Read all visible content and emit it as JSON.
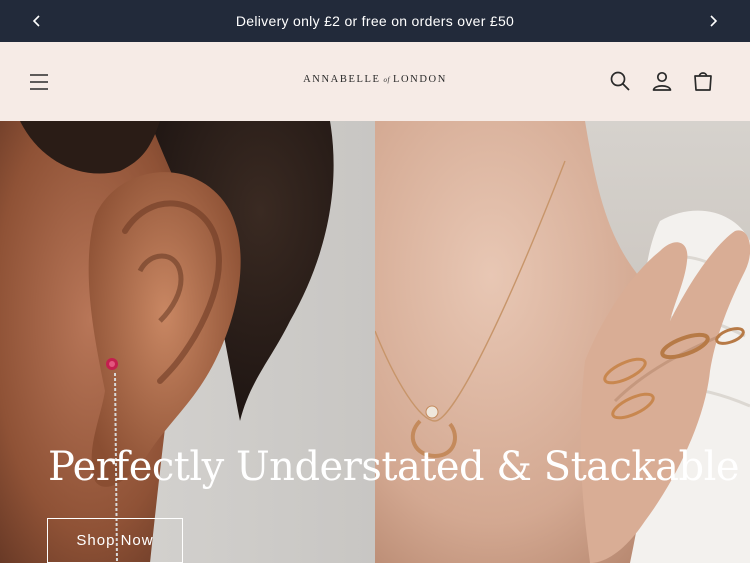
{
  "announcement": {
    "text": "Delivery only £2 or free on orders over £50",
    "prev_icon": "chevron-left-icon",
    "next_icon": "chevron-right-icon"
  },
  "header": {
    "logo_main_1": "ANNABELLE",
    "logo_of": "of",
    "logo_main_2": "LONDON",
    "menu_icon": "hamburger-menu-icon",
    "search_icon": "search-icon",
    "account_icon": "user-icon",
    "cart_icon": "shopping-bag-icon"
  },
  "hero": {
    "title": "Perfectly Understated & Stackable",
    "button_label": "Shop Now"
  },
  "colors": {
    "announcement_bg": "#222a3a",
    "header_bg": "#f6ebe6",
    "text_dark": "#2a2a2a",
    "white": "#ffffff"
  }
}
